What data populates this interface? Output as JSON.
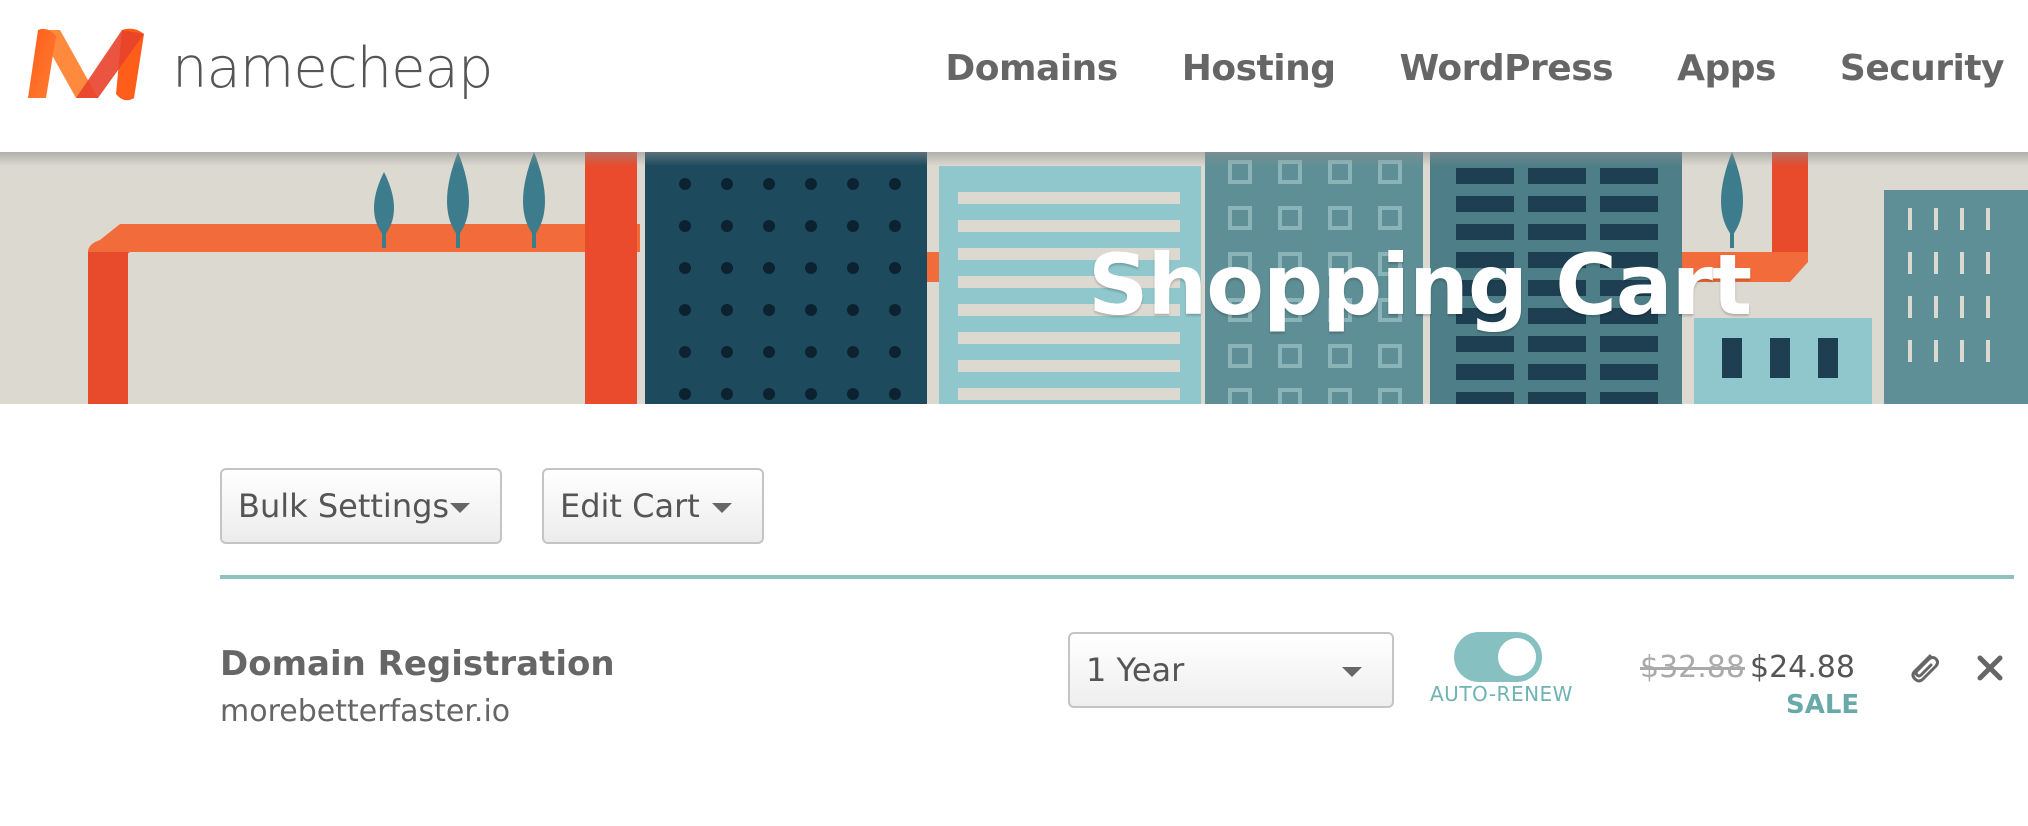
{
  "brand": {
    "name": "namecheap",
    "logo_colors": [
      "#ff5d1a",
      "#ff8a3d",
      "#e8412b"
    ]
  },
  "nav": {
    "items": [
      "Domains",
      "Hosting",
      "WordPress",
      "Apps",
      "Security"
    ]
  },
  "banner": {
    "title": "Shopping Cart"
  },
  "toolbar": {
    "bulk_settings_label": "Bulk Settings",
    "edit_cart_label": "Edit Cart"
  },
  "cart": {
    "items": [
      {
        "type": "Domain Registration",
        "domain": "morebetterfaster.io",
        "term": "1 Year",
        "auto_renew_label": "AUTO-RENEW",
        "auto_renew_on": true,
        "original_price": "$32.88",
        "price": "$24.88",
        "badge": "SALE",
        "actions": [
          "paperclip-icon",
          "close-icon"
        ]
      }
    ]
  },
  "colors": {
    "accent_teal": "#86c0c1",
    "divider": "#8fc1c1",
    "brand_orange": "#ff5d1a"
  }
}
